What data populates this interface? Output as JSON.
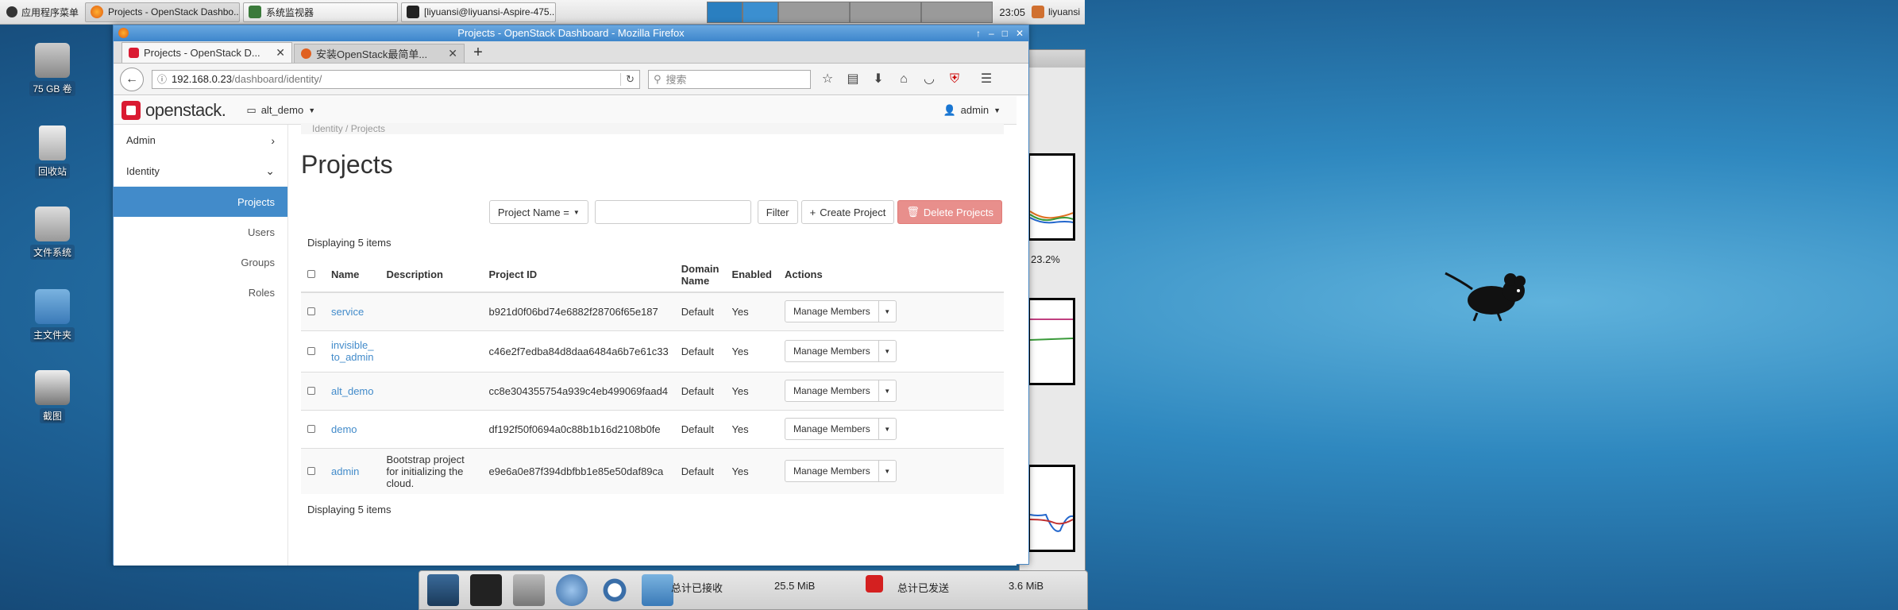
{
  "taskbar": {
    "apps_menu": "应用程序菜单",
    "tasks": [
      {
        "label": "Projects - OpenStack Dashbo...",
        "icon": "firefox-icon"
      },
      {
        "label": "系统监视器",
        "icon": "system-monitor-icon"
      },
      {
        "label": "[liyuansi@liyuansi-Aspire-475...",
        "icon": "terminal-icon"
      }
    ],
    "clock": "23:05",
    "user": "liyuansi"
  },
  "desktop_icons": [
    {
      "label": "75 GB 卷",
      "icon": "drive-icon"
    },
    {
      "label": "回收站",
      "icon": "trash-icon"
    },
    {
      "label": "文件系统",
      "icon": "filesystem-icon"
    },
    {
      "label": "主文件夹",
      "icon": "home-folder-icon"
    },
    {
      "label": "截图",
      "icon": "screenshot-icon"
    }
  ],
  "system_monitor": {
    "cpu_percent": "23.2%"
  },
  "network": {
    "recv_label": "总计已接收",
    "recv_value": "25.5 MiB",
    "sent_label": "总计已发送",
    "sent_value": "3.6 MiB"
  },
  "firefox": {
    "window_title": "Projects - OpenStack Dashboard - Mozilla Firefox",
    "tabs": [
      {
        "label": "Projects - OpenStack D..."
      },
      {
        "label": "安装OpenStack最简单..."
      }
    ],
    "url_host": "192.168.0.23",
    "url_path": "/dashboard/identity/",
    "search_placeholder": "搜索"
  },
  "openstack": {
    "brand": "openstack.",
    "project": "alt_demo",
    "user": "admin",
    "sidebar": {
      "admin": "Admin",
      "identity": "Identity",
      "items": [
        "Projects",
        "Users",
        "Groups",
        "Roles"
      ]
    },
    "breadcrumb": "Identity  /  Projects",
    "page_title": "Projects",
    "filter_select": "Project Name =",
    "filter_button": "Filter",
    "create_button": "Create Project",
    "delete_button": "Delete Projects",
    "count_text": "Displaying 5 items",
    "columns": [
      "Name",
      "Description",
      "Project ID",
      "Domain Name",
      "Enabled",
      "Actions"
    ],
    "rows": [
      {
        "name": "service",
        "description": "",
        "id": "b921d0f06bd74e6882f28706f65e187",
        "domain": "Default",
        "enabled": "Yes",
        "action": "Manage Members"
      },
      {
        "name": "invisible_to_admin",
        "description": "",
        "id": "c46e2f7edba84d8daa6484a6b7e61c33",
        "domain": "Default",
        "enabled": "Yes",
        "action": "Manage Members"
      },
      {
        "name": "alt_demo",
        "description": "",
        "id": "cc8e304355754a939c4eb499069faad4",
        "domain": "Default",
        "enabled": "Yes",
        "action": "Manage Members"
      },
      {
        "name": "demo",
        "description": "",
        "id": "df192f50f0694a0c88b1b16d2108b0fe",
        "domain": "Default",
        "enabled": "Yes",
        "action": "Manage Members"
      },
      {
        "name": "admin",
        "description": "Bootstrap project for initializing the cloud.",
        "id": "e9e6a0e87f394dbfbb1e85e50daf89ca",
        "domain": "Default",
        "enabled": "Yes",
        "action": "Manage Members"
      }
    ]
  },
  "colors": {
    "accent": "#428bca",
    "danger": "#e88f8c",
    "brand_red": "#da1a32"
  }
}
